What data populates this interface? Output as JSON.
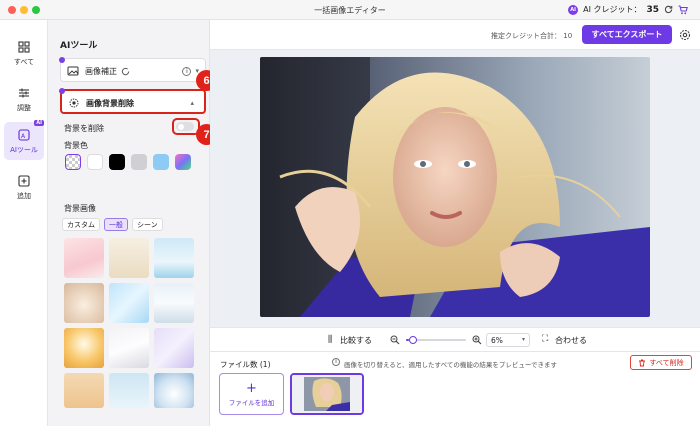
{
  "window": {
    "title": "一括画像エディター"
  },
  "credits": {
    "label": "AI クレジット：",
    "value": "35"
  },
  "nav": {
    "items": [
      {
        "label": "すべて"
      },
      {
        "label": "調整"
      },
      {
        "label": "AIツール",
        "badge": "AI"
      },
      {
        "label": "追加"
      }
    ]
  },
  "panel": {
    "title": "AIツール",
    "enhance_label": "画像補正",
    "enhance_info": "i",
    "remove_bg_label": "画像背景削除",
    "remove_bg_toggle_label": "背景を削除",
    "bg_color_label": "背景色",
    "bg_image_label": "背景画像",
    "bg_tabs": [
      "カスタム",
      "一般",
      "シーン"
    ],
    "swatch_colors": [
      "transparent",
      "#ffffff",
      "#000000",
      "#cfcfd4",
      "#8ecbf4",
      "gradient"
    ],
    "toggle_on": false
  },
  "toolbar": {
    "estimate_label": "推定クレジット合計：",
    "estimate_value": "10",
    "export_label": "すべてエクスポート"
  },
  "controls": {
    "compare_label": "比較する",
    "zoom_value": "6%",
    "zoom_fraction": 0.05,
    "fit_label": "合わせる"
  },
  "files": {
    "count_label": "ファイル数 (1)",
    "hint": "画像を切り替えると、適用したすべての機能の結果をプレビューできます",
    "delete_all_label": "すべて削除",
    "add_label": "ファイルを追加",
    "add_plus": "+"
  },
  "callouts": [
    "6",
    "7"
  ]
}
